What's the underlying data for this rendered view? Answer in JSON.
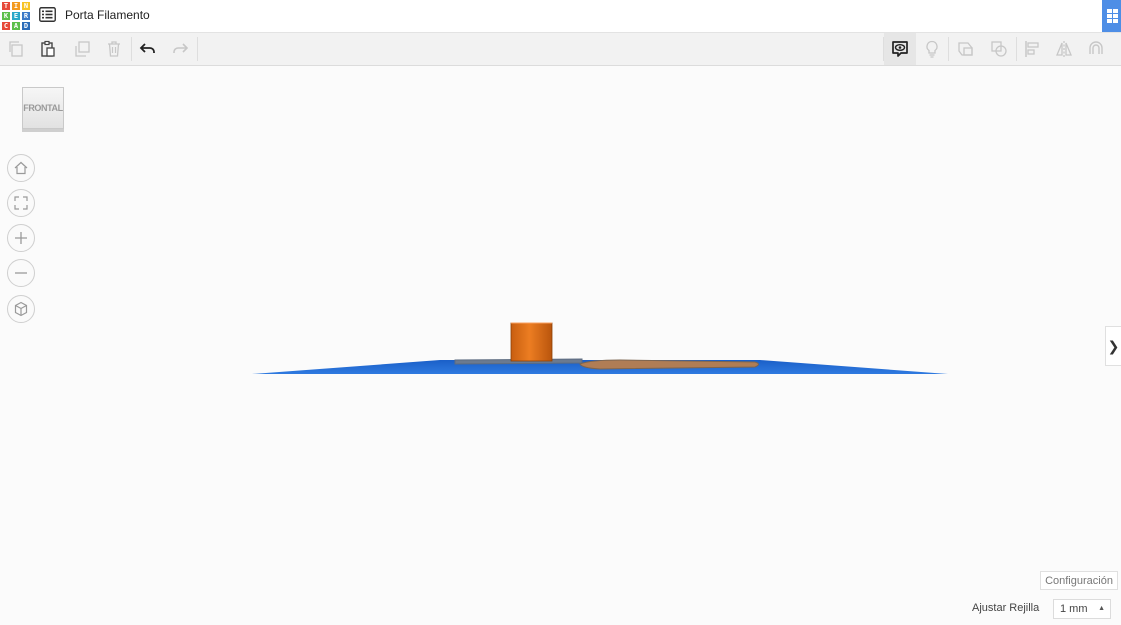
{
  "header": {
    "logo_letters": [
      "T",
      "I",
      "N",
      "K",
      "E",
      "R",
      "C",
      "A",
      "D"
    ],
    "project_title": "Porta Filamento"
  },
  "viewcube": {
    "face_label": "FRONTAL"
  },
  "bottom": {
    "config_label": "Configuración",
    "grid_label": "Ajustar Rejilla",
    "grid_value": "1 mm"
  },
  "colors": {
    "workplane_blue": "#1d62c9",
    "shape_orange": "#e07018",
    "accent_blue": "#4e8ee6"
  }
}
